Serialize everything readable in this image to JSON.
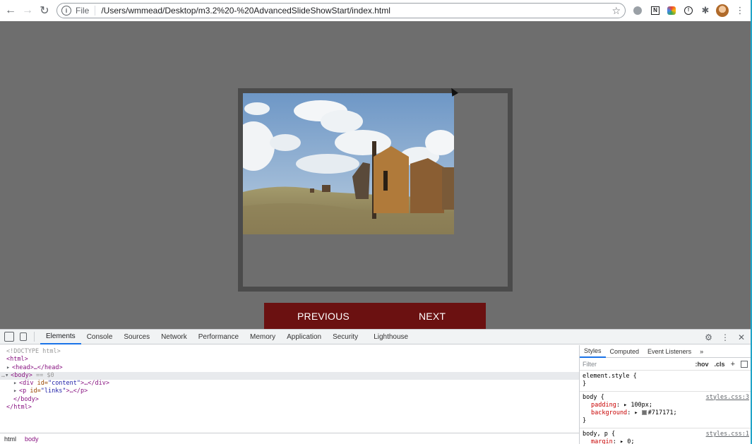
{
  "browser": {
    "scheme_label": "File",
    "url": "/Users/wmmead/Desktop/m3.2%20-%20AdvancedSlideShowStart/index.html"
  },
  "page": {
    "background_color": "#717171",
    "links_background": "#6b1111",
    "previous_label": "PREVIOUS",
    "next_label": "NEXT"
  },
  "devtools": {
    "tabs": [
      "Elements",
      "Console",
      "Sources",
      "Network",
      "Performance",
      "Memory",
      "Application",
      "Security",
      "Lighthouse"
    ],
    "active_tab": "Elements",
    "dom": {
      "doctype": "<!DOCTYPE html>",
      "html_open": "<html>",
      "head": "<head>…</head>",
      "body_open": "<body>",
      "body_eq": "== $0",
      "div_tag": "<div ",
      "div_attr": "id=",
      "div_val": "\"content\"",
      "div_rest": ">…</div>",
      "p_tag": "<p ",
      "p_attr": "id=",
      "p_val": "\"links\"",
      "p_rest": ">…</p>",
      "body_close": "</body>",
      "html_close": "</html>"
    },
    "breadcrumbs": [
      "html",
      "body"
    ],
    "styles_tabs": [
      "Styles",
      "Computed",
      "Event Listeners"
    ],
    "filter_placeholder": "Filter",
    "hov": ":hov",
    "cls": ".cls",
    "rules": {
      "element_style": "element.style {",
      "close": "}",
      "body_selector": "body {",
      "body_source": "styles.css:3",
      "padding_name": "padding",
      "padding_value": "100px;",
      "background_name": "background",
      "background_value": "#717171;",
      "bp_selector": "body, p {",
      "bp_source": "styles.css:1",
      "margin_name": "margin",
      "margin_value": "0;"
    }
  }
}
